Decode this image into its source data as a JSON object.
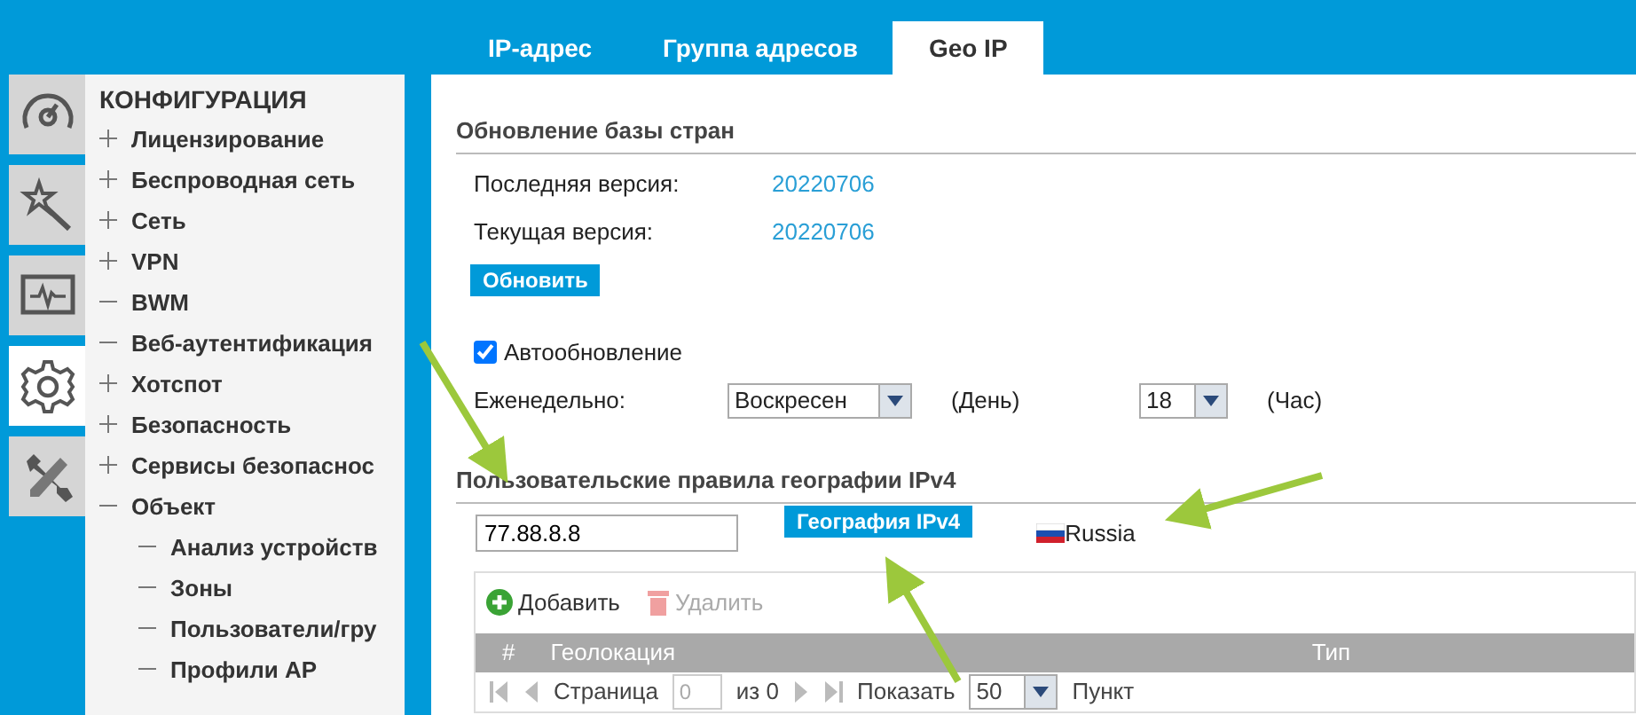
{
  "sidebar": {
    "tiles": [
      {
        "kind": "gauge",
        "selected": false
      },
      {
        "kind": "wand",
        "selected": false
      },
      {
        "kind": "monitor",
        "selected": false
      },
      {
        "kind": "gear",
        "selected": true
      },
      {
        "kind": "tools",
        "selected": false
      }
    ],
    "title": "КОНФИГУРАЦИЯ",
    "items": [
      {
        "label": "Лицензирование",
        "kind": "folder",
        "expanded": false
      },
      {
        "label": "Беспроводная сеть",
        "kind": "folder",
        "expanded": false
      },
      {
        "label": "Сеть",
        "kind": "folder",
        "expanded": false
      },
      {
        "label": "VPN",
        "kind": "folder",
        "expanded": false
      },
      {
        "label": "BWM",
        "kind": "leaf"
      },
      {
        "label": "Веб-аутентификация",
        "kind": "leaf"
      },
      {
        "label": "Хотспот",
        "kind": "folder",
        "expanded": false
      },
      {
        "label": "Безопасность",
        "kind": "folder",
        "expanded": false
      },
      {
        "label": "Сервисы безопаснос",
        "kind": "folder",
        "expanded": false
      },
      {
        "label": "Объект",
        "kind": "folder",
        "expanded": true,
        "children": [
          {
            "label": "Анализ устройств",
            "kind": "leaf"
          },
          {
            "label": "Зоны",
            "kind": "leaf"
          },
          {
            "label": "Пользователи/гру",
            "kind": "leaf"
          },
          {
            "label": "Профили AP",
            "kind": "leaf"
          }
        ]
      }
    ]
  },
  "tabs": [
    {
      "label": "IP-адрес",
      "selected": false
    },
    {
      "label": "Группа адресов",
      "selected": false
    },
    {
      "label": "Geo IP",
      "selected": true
    }
  ],
  "update_section": {
    "title": "Обновление базы стран",
    "rows": [
      {
        "label": "Последняя версия:",
        "value": "20220706"
      },
      {
        "label": "Текущая версия:",
        "value": "20220706"
      }
    ],
    "update_button": "Обновить",
    "auto_update": {
      "label": "Автообновление",
      "checked": true
    },
    "schedule": {
      "label": "Еженедельно:",
      "day": "Воскресен",
      "day_unit": "(День)",
      "hour": "18",
      "hour_unit": "(Час)"
    }
  },
  "rules_section": {
    "title": "Пользовательские правила географии IPv4",
    "ip_value": "77.88.8.8",
    "lookup_button": "География IPv4",
    "result": "Russia",
    "toolbar": [
      {
        "kind": "add",
        "label": "Добавить",
        "disabled": false
      },
      {
        "kind": "delete",
        "label": "Удалить",
        "disabled": true
      }
    ],
    "columns": [
      "#",
      "Геолокация",
      "Тип"
    ],
    "pager": {
      "nav_disabled": true,
      "page_label": "Страница",
      "page": "0",
      "of": "из 0",
      "show_label": "Показать",
      "per_page": "50",
      "unit": "Пункт"
    }
  }
}
